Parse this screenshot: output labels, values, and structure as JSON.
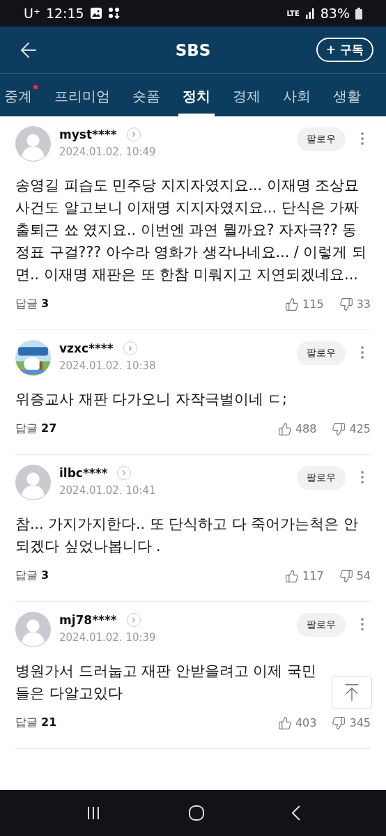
{
  "status_bar": {
    "carrier": "U⁺",
    "time": "12:15",
    "network": "LTE",
    "battery": "83%"
  },
  "header": {
    "title": "SBS",
    "subscribe": "+ 구독"
  },
  "tabs": [
    {
      "label": "중계",
      "selected": false,
      "has_new": true
    },
    {
      "label": "프리미엄",
      "selected": false,
      "has_new": false
    },
    {
      "label": "숏폼",
      "selected": false,
      "has_new": false
    },
    {
      "label": "정치",
      "selected": true,
      "has_new": false
    },
    {
      "label": "경제",
      "selected": false,
      "has_new": false
    },
    {
      "label": "사회",
      "selected": false,
      "has_new": false
    },
    {
      "label": "생활",
      "selected": false,
      "has_new": false
    }
  ],
  "comments": [
    {
      "avatar": {
        "kind": "default"
      },
      "user": "myst****",
      "date": "2024.01.02. 10:49",
      "follow": "팔로우",
      "text": "송영길 피습도 민주당 지지자였지요... 이재명 조상묘 사건도 알고보니 이재명 지지자였지요... 단식은 가짜 출퇴근 쑈 였지요.. 이번엔 과연 뭘까요? 자자극?? 동정표 구걸??? 아수라 영화가 생각나네요... / 이렇게 되면.. 이재명 재판은 또 한참 미뤄지고 지연되겠네요...",
      "replies_label": "답글",
      "replies": "3",
      "likes": "115",
      "dislikes": "33"
    },
    {
      "user": "vzxc****",
      "date": "2024.01.02. 10:38",
      "follow": "팔로우",
      "text": "위증교사 재판 다가오니 자작극벌이네 ㄷ;",
      "replies_label": "답글",
      "replies": "27",
      "likes": "488",
      "dislikes": "425"
    },
    {
      "avatar": {
        "kind": "default"
      },
      "user": "ilbc****",
      "date": "2024.01.02. 10:41",
      "follow": "팔로우",
      "text": "참... 가지가지한다.. 또 단식하고 다 죽어가는척은 안되겠다 싶었나봅니다 .",
      "replies_label": "답글",
      "replies": "3",
      "likes": "117",
      "dislikes": "54"
    },
    {
      "avatar": {
        "kind": "default"
      },
      "user": "mj78****",
      "date": "2024.01.02. 10:39",
      "follow": "팔로우",
      "text": "병원가서 드러눕고 재판 안받을려고 이제 국민들은 다알고있다",
      "replies_label": "답글",
      "replies": "21",
      "likes": "403",
      "dislikes": "345"
    }
  ]
}
